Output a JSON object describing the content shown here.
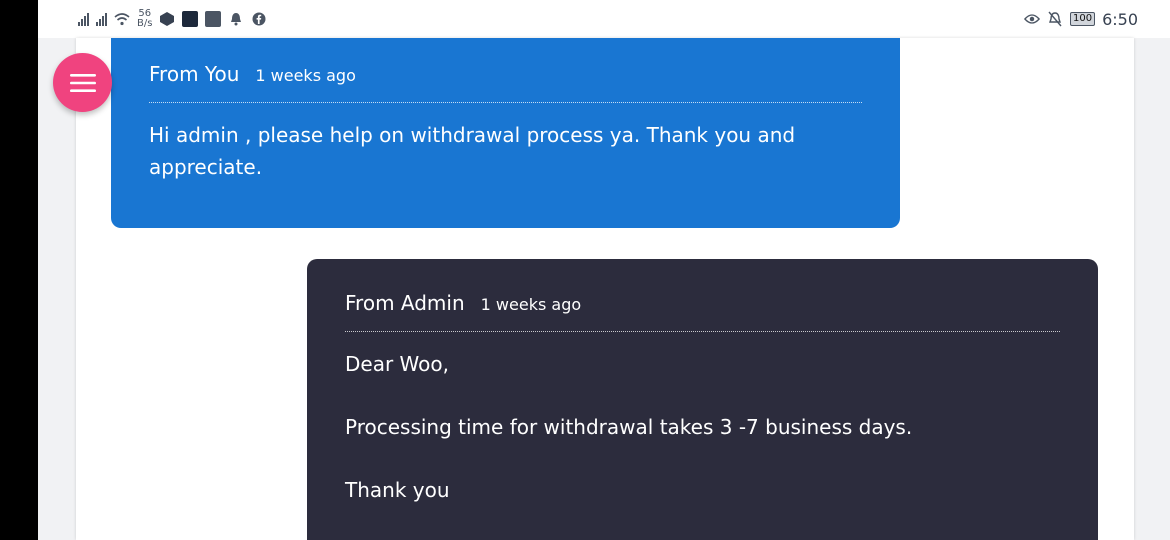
{
  "status_bar": {
    "net_speed_value": "56",
    "net_speed_unit": "B/s",
    "battery": "100",
    "time": "6:50",
    "icons": [
      "signal-icon",
      "signal-icon",
      "wifi-icon",
      "app-icon",
      "app-icon",
      "app-icon",
      "notification-bell-icon",
      "facebook-icon",
      "eye-icon",
      "bell-off-icon",
      "battery-icon"
    ]
  },
  "menu_button": {
    "icon": "hamburger-menu-icon",
    "color": "#f0437f"
  },
  "messages": [
    {
      "sender": "From You",
      "time": "1 weeks ago",
      "body": [
        "Hi admin , please help on withdrawal process ya. Thank you and appreciate."
      ],
      "color": "#1976d2"
    },
    {
      "sender": "From Admin",
      "time": "1 weeks ago",
      "body": [
        "Dear Woo,",
        "Processing time for withdrawal takes 3 -7 business days.",
        "Thank you"
      ],
      "color": "#2c2c3d"
    }
  ]
}
